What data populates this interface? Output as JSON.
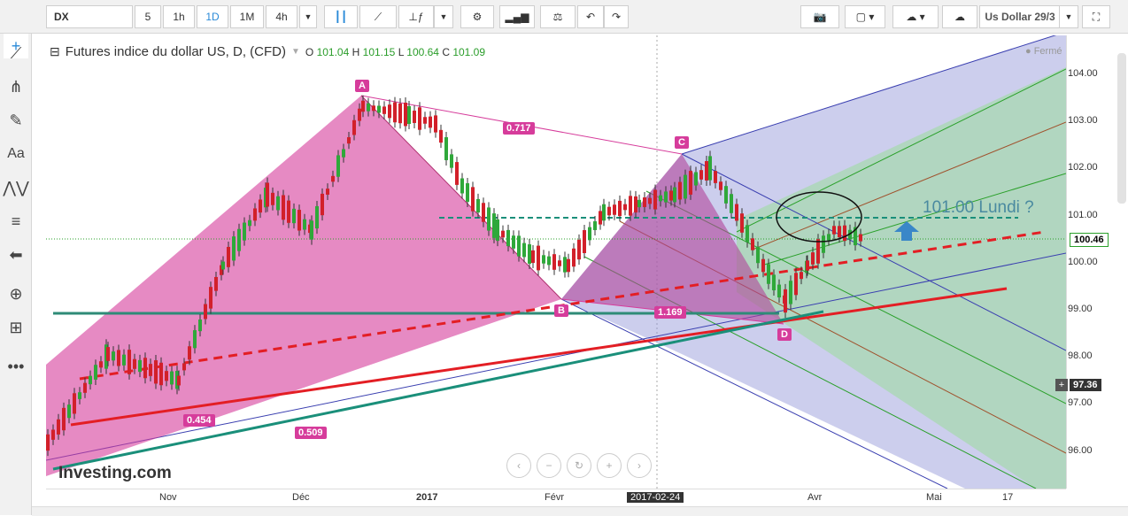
{
  "toolbar": {
    "symbol": "DX",
    "intervals": [
      "5",
      "1h",
      "1D",
      "1M",
      "4h"
    ],
    "active_interval": "1D",
    "layout_name": "Us Dollar 29/3"
  },
  "legend": {
    "title": "Futures indice du dollar US, D, (CFD)",
    "o_label": "O",
    "o": "101.04",
    "h_label": "H",
    "h": "101.15",
    "l_label": "L",
    "l": "100.64",
    "c_label": "C",
    "c": "101.09",
    "status": "Fermé"
  },
  "y_axis": [
    "104.00",
    "103.00",
    "102.00",
    "101.00",
    "100.00",
    "99.00",
    "98.00",
    "97.00",
    "96.00"
  ],
  "price_tags": {
    "last": "100.46",
    "cursor": "97.36"
  },
  "x_axis": [
    "Nov",
    "Déc",
    "2017",
    "Févr",
    "2017-02-24",
    "Avr",
    "Mai",
    "17"
  ],
  "annotations": {
    "point_a": "A",
    "point_b": "B",
    "point_c": "C",
    "point_d": "D",
    "ratio_ac": "0.717",
    "ratio_bd": "1.169",
    "ratio_x": "0.454",
    "ratio_xb": "0.509",
    "note": "101.00 Lundi ?"
  },
  "watermark": "Investing.com",
  "colors": {
    "up": "#2fa83a",
    "down": "#d2202a",
    "pattern": "#d63c9b",
    "pitch_blue": "#7b7fd0",
    "pitch_green": "#8fd68f"
  }
}
